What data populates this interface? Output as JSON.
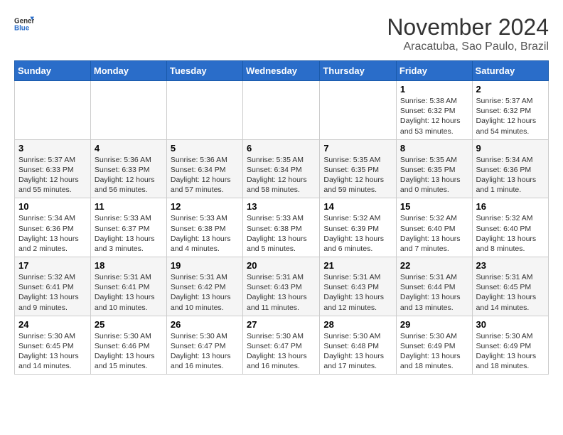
{
  "logo": {
    "line1": "General",
    "line2": "Blue"
  },
  "title": "November 2024",
  "subtitle": "Aracatuba, Sao Paulo, Brazil",
  "weekdays": [
    "Sunday",
    "Monday",
    "Tuesday",
    "Wednesday",
    "Thursday",
    "Friday",
    "Saturday"
  ],
  "weeks": [
    [
      {
        "day": "",
        "info": ""
      },
      {
        "day": "",
        "info": ""
      },
      {
        "day": "",
        "info": ""
      },
      {
        "day": "",
        "info": ""
      },
      {
        "day": "",
        "info": ""
      },
      {
        "day": "1",
        "info": "Sunrise: 5:38 AM\nSunset: 6:32 PM\nDaylight: 12 hours and 53 minutes."
      },
      {
        "day": "2",
        "info": "Sunrise: 5:37 AM\nSunset: 6:32 PM\nDaylight: 12 hours and 54 minutes."
      }
    ],
    [
      {
        "day": "3",
        "info": "Sunrise: 5:37 AM\nSunset: 6:33 PM\nDaylight: 12 hours and 55 minutes."
      },
      {
        "day": "4",
        "info": "Sunrise: 5:36 AM\nSunset: 6:33 PM\nDaylight: 12 hours and 56 minutes."
      },
      {
        "day": "5",
        "info": "Sunrise: 5:36 AM\nSunset: 6:34 PM\nDaylight: 12 hours and 57 minutes."
      },
      {
        "day": "6",
        "info": "Sunrise: 5:35 AM\nSunset: 6:34 PM\nDaylight: 12 hours and 58 minutes."
      },
      {
        "day": "7",
        "info": "Sunrise: 5:35 AM\nSunset: 6:35 PM\nDaylight: 12 hours and 59 minutes."
      },
      {
        "day": "8",
        "info": "Sunrise: 5:35 AM\nSunset: 6:35 PM\nDaylight: 13 hours and 0 minutes."
      },
      {
        "day": "9",
        "info": "Sunrise: 5:34 AM\nSunset: 6:36 PM\nDaylight: 13 hours and 1 minute."
      }
    ],
    [
      {
        "day": "10",
        "info": "Sunrise: 5:34 AM\nSunset: 6:36 PM\nDaylight: 13 hours and 2 minutes."
      },
      {
        "day": "11",
        "info": "Sunrise: 5:33 AM\nSunset: 6:37 PM\nDaylight: 13 hours and 3 minutes."
      },
      {
        "day": "12",
        "info": "Sunrise: 5:33 AM\nSunset: 6:38 PM\nDaylight: 13 hours and 4 minutes."
      },
      {
        "day": "13",
        "info": "Sunrise: 5:33 AM\nSunset: 6:38 PM\nDaylight: 13 hours and 5 minutes."
      },
      {
        "day": "14",
        "info": "Sunrise: 5:32 AM\nSunset: 6:39 PM\nDaylight: 13 hours and 6 minutes."
      },
      {
        "day": "15",
        "info": "Sunrise: 5:32 AM\nSunset: 6:40 PM\nDaylight: 13 hours and 7 minutes."
      },
      {
        "day": "16",
        "info": "Sunrise: 5:32 AM\nSunset: 6:40 PM\nDaylight: 13 hours and 8 minutes."
      }
    ],
    [
      {
        "day": "17",
        "info": "Sunrise: 5:32 AM\nSunset: 6:41 PM\nDaylight: 13 hours and 9 minutes."
      },
      {
        "day": "18",
        "info": "Sunrise: 5:31 AM\nSunset: 6:41 PM\nDaylight: 13 hours and 10 minutes."
      },
      {
        "day": "19",
        "info": "Sunrise: 5:31 AM\nSunset: 6:42 PM\nDaylight: 13 hours and 10 minutes."
      },
      {
        "day": "20",
        "info": "Sunrise: 5:31 AM\nSunset: 6:43 PM\nDaylight: 13 hours and 11 minutes."
      },
      {
        "day": "21",
        "info": "Sunrise: 5:31 AM\nSunset: 6:43 PM\nDaylight: 13 hours and 12 minutes."
      },
      {
        "day": "22",
        "info": "Sunrise: 5:31 AM\nSunset: 6:44 PM\nDaylight: 13 hours and 13 minutes."
      },
      {
        "day": "23",
        "info": "Sunrise: 5:31 AM\nSunset: 6:45 PM\nDaylight: 13 hours and 14 minutes."
      }
    ],
    [
      {
        "day": "24",
        "info": "Sunrise: 5:30 AM\nSunset: 6:45 PM\nDaylight: 13 hours and 14 minutes."
      },
      {
        "day": "25",
        "info": "Sunrise: 5:30 AM\nSunset: 6:46 PM\nDaylight: 13 hours and 15 minutes."
      },
      {
        "day": "26",
        "info": "Sunrise: 5:30 AM\nSunset: 6:47 PM\nDaylight: 13 hours and 16 minutes."
      },
      {
        "day": "27",
        "info": "Sunrise: 5:30 AM\nSunset: 6:47 PM\nDaylight: 13 hours and 16 minutes."
      },
      {
        "day": "28",
        "info": "Sunrise: 5:30 AM\nSunset: 6:48 PM\nDaylight: 13 hours and 17 minutes."
      },
      {
        "day": "29",
        "info": "Sunrise: 5:30 AM\nSunset: 6:49 PM\nDaylight: 13 hours and 18 minutes."
      },
      {
        "day": "30",
        "info": "Sunrise: 5:30 AM\nSunset: 6:49 PM\nDaylight: 13 hours and 18 minutes."
      }
    ]
  ]
}
